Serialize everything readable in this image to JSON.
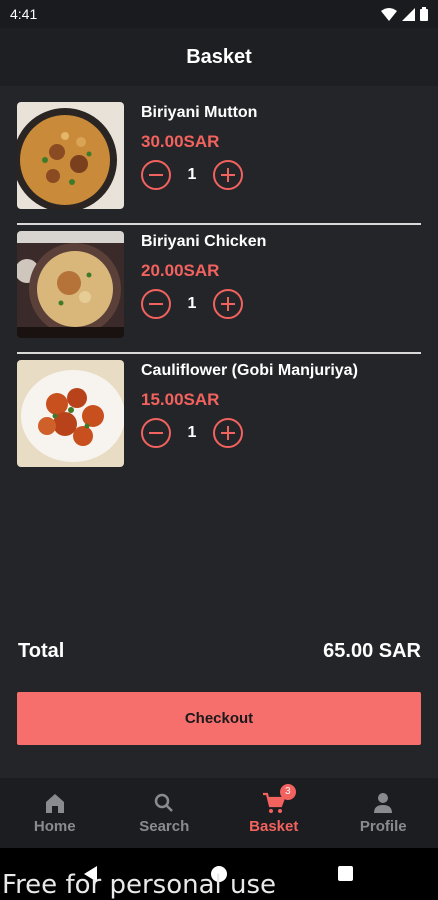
{
  "status_bar": {
    "time": "4:41"
  },
  "header": {
    "title": "Basket"
  },
  "items": [
    {
      "name": "Biriyani Mutton",
      "price": "30.00SAR",
      "qty": "1",
      "image_icon": "biriyani-mutton-image"
    },
    {
      "name": "Biriyani Chicken",
      "price": "20.00SAR",
      "qty": "1",
      "image_icon": "biriyani-chicken-image"
    },
    {
      "name": "Cauliflower (Gobi Manjuriya)",
      "price": "15.00SAR",
      "qty": "1",
      "image_icon": "gobi-manjuriya-image"
    }
  ],
  "total": {
    "label": "Total",
    "value": "65.00 SAR"
  },
  "checkout": {
    "label": "Checkout"
  },
  "bottom_nav": {
    "items": [
      {
        "label": "Home",
        "icon": "home-icon",
        "active": false
      },
      {
        "label": "Search",
        "icon": "search-icon",
        "active": false
      },
      {
        "label": "Basket",
        "icon": "cart-icon",
        "active": true,
        "badge": "3"
      },
      {
        "label": "Profile",
        "icon": "person-icon",
        "active": false
      }
    ]
  },
  "watermark": "Free for personal use",
  "colors": {
    "accent": "#f2625e",
    "button": "#f76f6d",
    "background": "#242529"
  }
}
